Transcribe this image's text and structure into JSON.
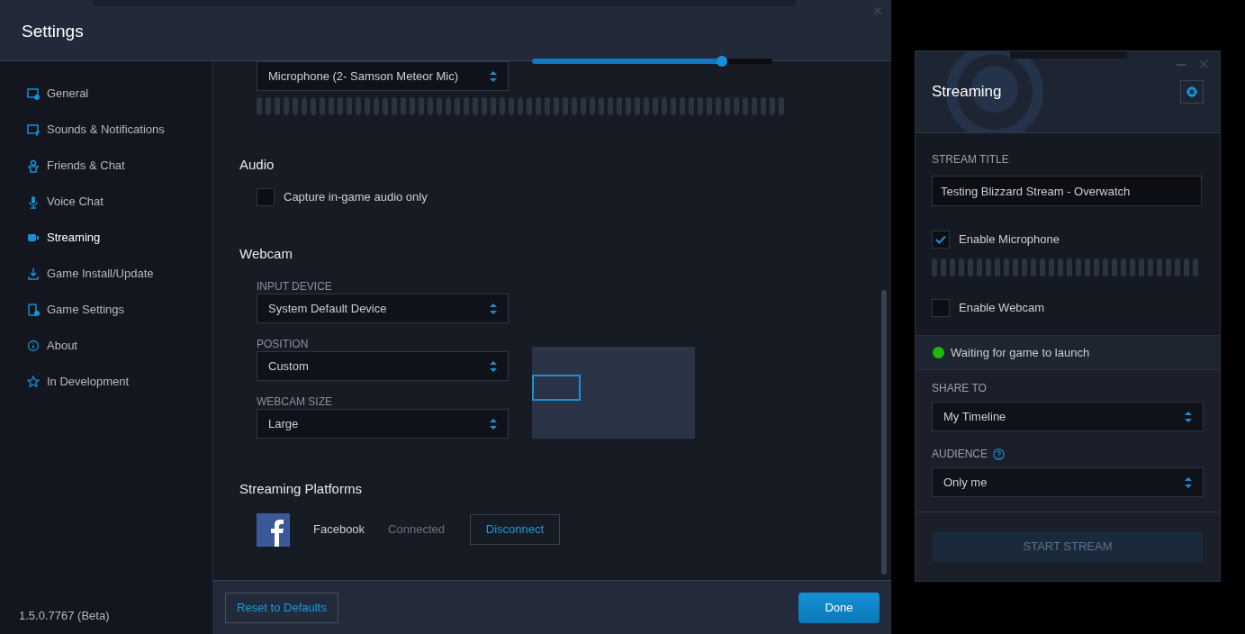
{
  "settings_window": {
    "title": "Settings",
    "sidebar": {
      "items": [
        {
          "label": "General",
          "selected": false
        },
        {
          "label": "Sounds & Notifications",
          "selected": false
        },
        {
          "label": "Friends & Chat",
          "selected": false
        },
        {
          "label": "Voice Chat",
          "selected": false
        },
        {
          "label": "Streaming",
          "selected": true
        },
        {
          "label": "Game Install/Update",
          "selected": false
        },
        {
          "label": "Game Settings",
          "selected": false
        },
        {
          "label": "About",
          "selected": false
        },
        {
          "label": "In Development",
          "selected": false
        }
      ],
      "version": "1.5.0.7767 (Beta)"
    },
    "microphone": {
      "device": "Microphone (2- Samson Meteor Mic)",
      "volume": {
        "level": 0.79
      }
    },
    "audio": {
      "heading": "Audio",
      "capture_in_game_only": {
        "label": "Capture in-game audio only",
        "checked": false
      }
    },
    "webcam": {
      "heading": "Webcam",
      "fields": [
        {
          "label": "INPUT DEVICE",
          "value": "System Default Device"
        },
        {
          "label": "POSITION",
          "value": "Custom"
        },
        {
          "label": "WEBCAM SIZE",
          "value": "Large"
        }
      ]
    },
    "streaming_platforms": {
      "heading": "Streaming Platforms",
      "platforms": [
        {
          "name": "Facebook",
          "status": "Connected",
          "action": "Disconnect"
        }
      ]
    },
    "footer": {
      "reset": "Reset to Defaults",
      "done": "Done"
    }
  },
  "streaming_panel": {
    "title": "Streaming",
    "stream_title": {
      "label": "STREAM TITLE",
      "value": "Testing Blizzard Stream - Overwatch"
    },
    "enable_microphone": {
      "label": "Enable Microphone",
      "checked": true
    },
    "enable_webcam": {
      "label": "Enable Webcam",
      "checked": false
    },
    "status": {
      "text": "Waiting for game to launch",
      "color": "#1fb80f"
    },
    "share_to": {
      "label": "SHARE TO",
      "value": "My Timeline"
    },
    "audience": {
      "label": "AUDIENCE",
      "value": "Only me"
    },
    "start_button": {
      "label": "START STREAM",
      "disabled": true
    }
  }
}
